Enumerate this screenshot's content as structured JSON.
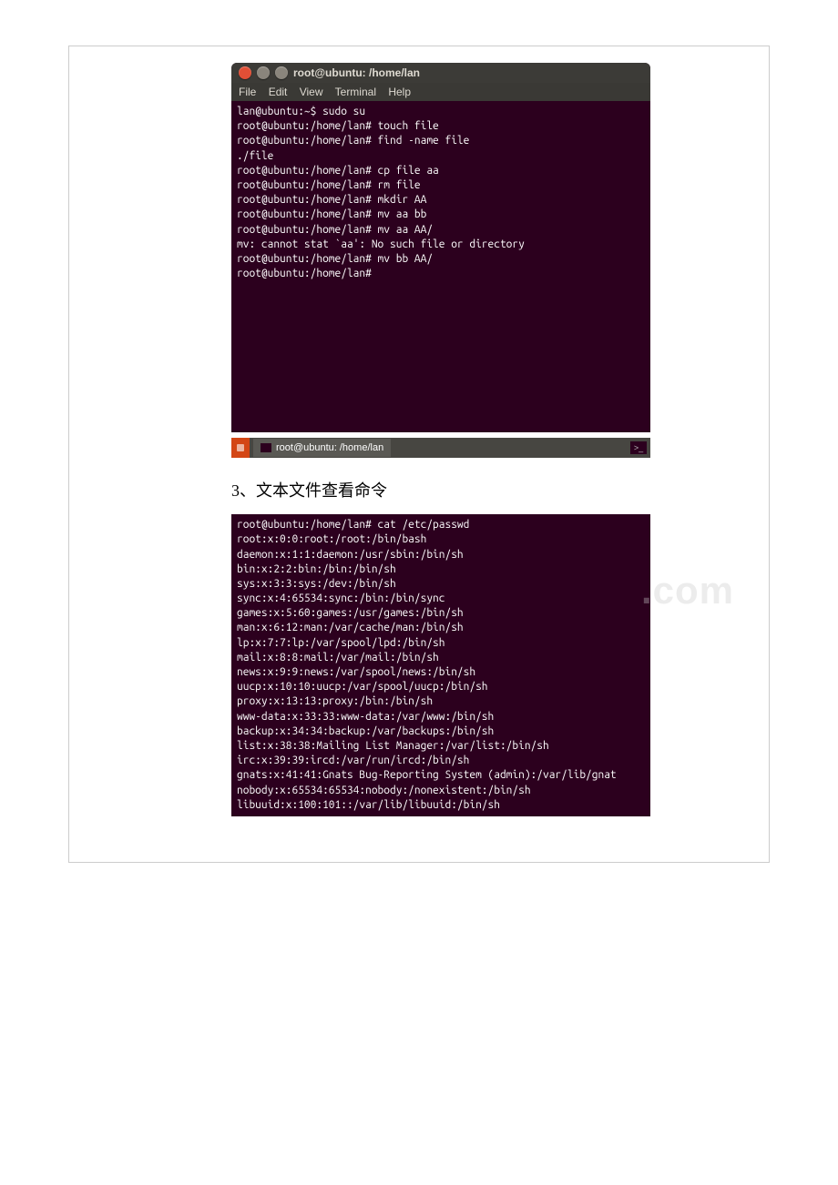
{
  "window": {
    "title": "root@ubuntu: /home/lan",
    "menu": {
      "file": "File",
      "edit": "Edit",
      "view": "View",
      "terminal": "Terminal",
      "help": "Help"
    }
  },
  "terminal1": {
    "lines": [
      "lan@ubuntu:~$ sudo su",
      "root@ubuntu:/home/lan# touch file",
      "root@ubuntu:/home/lan# find -name file",
      "./file",
      "root@ubuntu:/home/lan# cp file aa",
      "root@ubuntu:/home/lan# rm file",
      "root@ubuntu:/home/lan# mkdir AA",
      "root@ubuntu:/home/lan# mv aa bb",
      "root@ubuntu:/home/lan# mv aa AA/",
      "mv: cannot stat `aa': No such file or directory",
      "root@ubuntu:/home/lan# mv bb AA/",
      "root@ubuntu:/home/lan#"
    ]
  },
  "taskbar": {
    "item": "root@ubuntu: /home/lan"
  },
  "heading": "3、文本文件查看命令",
  "terminal2": {
    "lines": [
      "root@ubuntu:/home/lan# cat /etc/passwd",
      "root:x:0:0:root:/root:/bin/bash",
      "daemon:x:1:1:daemon:/usr/sbin:/bin/sh",
      "bin:x:2:2:bin:/bin:/bin/sh",
      "sys:x:3:3:sys:/dev:/bin/sh",
      "sync:x:4:65534:sync:/bin:/bin/sync",
      "games:x:5:60:games:/usr/games:/bin/sh",
      "man:x:6:12:man:/var/cache/man:/bin/sh",
      "lp:x:7:7:lp:/var/spool/lpd:/bin/sh",
      "mail:x:8:8:mail:/var/mail:/bin/sh",
      "news:x:9:9:news:/var/spool/news:/bin/sh",
      "uucp:x:10:10:uucp:/var/spool/uucp:/bin/sh",
      "proxy:x:13:13:proxy:/bin:/bin/sh",
      "www-data:x:33:33:www-data:/var/www:/bin/sh",
      "backup:x:34:34:backup:/var/backups:/bin/sh",
      "list:x:38:38:Mailing List Manager:/var/list:/bin/sh",
      "irc:x:39:39:ircd:/var/run/ircd:/bin/sh",
      "gnats:x:41:41:Gnats Bug-Reporting System (admin):/var/lib/gnat",
      "nobody:x:65534:65534:nobody:/nonexistent:/bin/sh",
      "libuuid:x:100:101::/var/lib/libuuid:/bin/sh"
    ]
  }
}
